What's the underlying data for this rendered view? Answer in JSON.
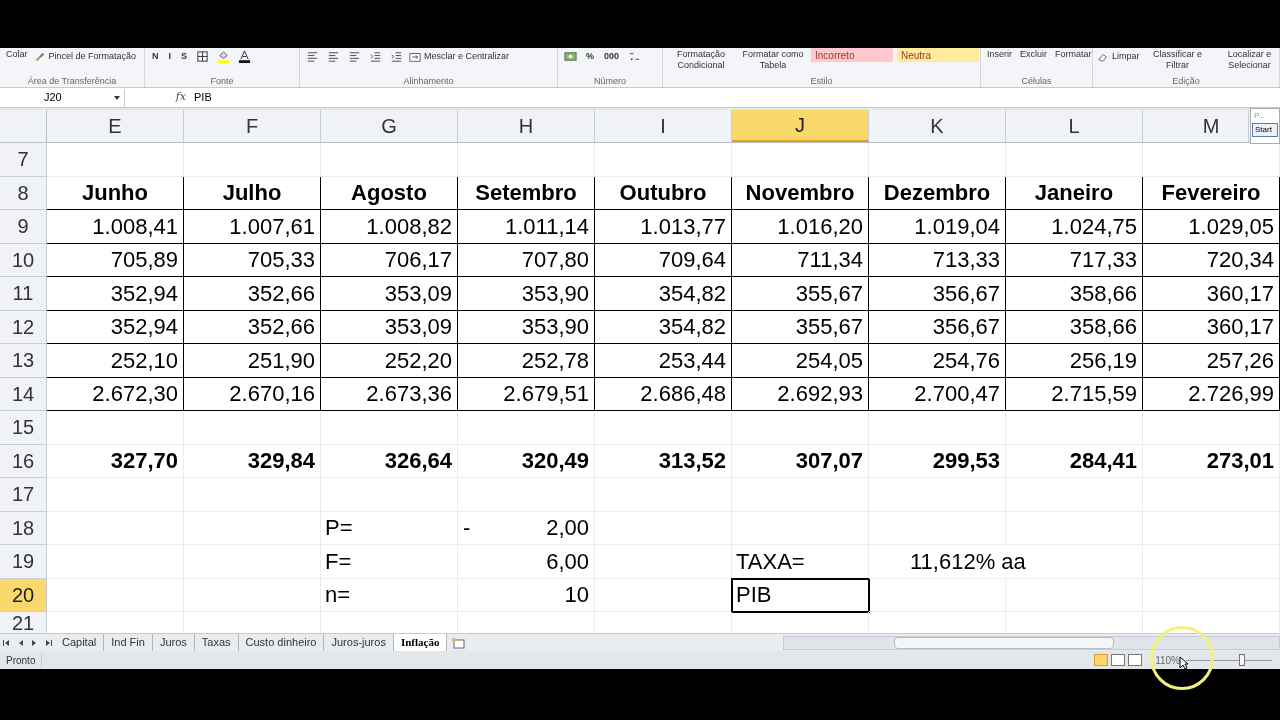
{
  "ribbon": {
    "groups": [
      {
        "label": "Área de Transferência",
        "buttons": [
          {
            "kind": "large",
            "text": "Colar"
          },
          {
            "kind": "small",
            "text": "Pincel de Formatação"
          }
        ]
      },
      {
        "label": "Fonte",
        "buttons": [
          {
            "kind": "glyph",
            "text": "N"
          },
          {
            "kind": "glyph",
            "text": "I"
          },
          {
            "kind": "glyph",
            "text": "S"
          }
        ]
      },
      {
        "label": "Alinhamento",
        "buttons": [
          {
            "kind": "small",
            "text": "Mesclar e Centralizar"
          }
        ]
      },
      {
        "label": "Número",
        "buttons": [
          {
            "kind": "glyph",
            "text": "%"
          },
          {
            "kind": "glyph",
            "text": "000"
          }
        ]
      },
      {
        "label": "Estilo",
        "buttons": [
          {
            "kind": "large",
            "text": "Formatação Condicional"
          },
          {
            "kind": "large",
            "text": "Formatar como Tabela"
          },
          {
            "kind": "style",
            "text": "Incorreto",
            "color": "#ffc7ce"
          },
          {
            "kind": "style",
            "text": "Neutra",
            "color": "#ffeb9c"
          }
        ]
      },
      {
        "label": "Células",
        "buttons": [
          {
            "kind": "large",
            "text": "Inserir"
          },
          {
            "kind": "large",
            "text": "Excluir"
          },
          {
            "kind": "large",
            "text": "Formatar"
          }
        ]
      },
      {
        "label": "Edição",
        "buttons": [
          {
            "kind": "small",
            "text": "Limpar"
          },
          {
            "kind": "large",
            "text": "Classificar e Filtrar"
          },
          {
            "kind": "large",
            "text": "Localizar e Selecionar"
          }
        ]
      }
    ]
  },
  "formula_bar": {
    "name_box": "J20",
    "function_label": "fx",
    "formula": "PIB"
  },
  "columns": [
    {
      "label": "E",
      "selected": false
    },
    {
      "label": "F",
      "selected": false
    },
    {
      "label": "G",
      "selected": false
    },
    {
      "label": "H",
      "selected": false
    },
    {
      "label": "I",
      "selected": false
    },
    {
      "label": "J",
      "selected": true
    },
    {
      "label": "K",
      "selected": false
    },
    {
      "label": "L",
      "selected": false
    },
    {
      "label": "M",
      "selected": false
    }
  ],
  "rows": [
    {
      "number": "7",
      "kind": "plain",
      "selected": false
    },
    {
      "number": "8",
      "kind": "table_header",
      "selected": false,
      "cells": [
        {
          "kind": "label",
          "text": "Junho"
        },
        {
          "kind": "label",
          "text": "Julho"
        },
        {
          "kind": "label",
          "text": "Agosto"
        },
        {
          "kind": "label",
          "text": "Setembro"
        },
        {
          "kind": "label",
          "text": "Outubro"
        },
        {
          "kind": "label",
          "text": "Novembro"
        },
        {
          "kind": "label",
          "text": "Dezembro"
        },
        {
          "kind": "label",
          "text": "Janeiro"
        },
        {
          "kind": "label",
          "text": "Fevereiro"
        }
      ]
    },
    {
      "number": "9",
      "kind": "table",
      "selected": false,
      "cells": [
        {
          "kind": "number",
          "text": "1.008,41"
        },
        {
          "kind": "number",
          "text": "1.007,61"
        },
        {
          "kind": "number",
          "text": "1.008,82"
        },
        {
          "kind": "number",
          "text": "1.011,14"
        },
        {
          "kind": "number",
          "text": "1.013,77"
        },
        {
          "kind": "number",
          "text": "1.016,20"
        },
        {
          "kind": "number",
          "text": "1.019,04"
        },
        {
          "kind": "number",
          "text": "1.024,75"
        },
        {
          "kind": "number",
          "text": "1.029,05"
        }
      ]
    },
    {
      "number": "10",
      "kind": "table",
      "selected": false,
      "cells": [
        {
          "kind": "number",
          "text": "705,89"
        },
        {
          "kind": "number",
          "text": "705,33"
        },
        {
          "kind": "number",
          "text": "706,17"
        },
        {
          "kind": "number",
          "text": "707,80"
        },
        {
          "kind": "number",
          "text": "709,64"
        },
        {
          "kind": "number",
          "text": "711,34"
        },
        {
          "kind": "number",
          "text": "713,33"
        },
        {
          "kind": "number",
          "text": "717,33"
        },
        {
          "kind": "number",
          "text": "720,34"
        }
      ]
    },
    {
      "number": "11",
      "kind": "table",
      "selected": false,
      "cells": [
        {
          "kind": "number",
          "text": "352,94"
        },
        {
          "kind": "number",
          "text": "352,66"
        },
        {
          "kind": "number",
          "text": "353,09"
        },
        {
          "kind": "number",
          "text": "353,90"
        },
        {
          "kind": "number",
          "text": "354,82"
        },
        {
          "kind": "number",
          "text": "355,67"
        },
        {
          "kind": "number",
          "text": "356,67"
        },
        {
          "kind": "number",
          "text": "358,66"
        },
        {
          "kind": "number",
          "text": "360,17"
        }
      ]
    },
    {
      "number": "12",
      "kind": "table",
      "selected": false,
      "cells": [
        {
          "kind": "number",
          "text": "352,94"
        },
        {
          "kind": "number",
          "text": "352,66"
        },
        {
          "kind": "number",
          "text": "353,09"
        },
        {
          "kind": "number",
          "text": "353,90"
        },
        {
          "kind": "number",
          "text": "354,82"
        },
        {
          "kind": "number",
          "text": "355,67"
        },
        {
          "kind": "number",
          "text": "356,67"
        },
        {
          "kind": "number",
          "text": "358,66"
        },
        {
          "kind": "number",
          "text": "360,17"
        }
      ]
    },
    {
      "number": "13",
      "kind": "table",
      "selected": false,
      "cells": [
        {
          "kind": "number",
          "text": "252,10"
        },
        {
          "kind": "number",
          "text": "251,90"
        },
        {
          "kind": "number",
          "text": "252,20"
        },
        {
          "kind": "number",
          "text": "252,78"
        },
        {
          "kind": "number",
          "text": "253,44"
        },
        {
          "kind": "number",
          "text": "254,05"
        },
        {
          "kind": "number",
          "text": "254,76"
        },
        {
          "kind": "number",
          "text": "256,19"
        },
        {
          "kind": "number",
          "text": "257,26"
        }
      ]
    },
    {
      "number": "14",
      "kind": "table",
      "selected": false,
      "cells": [
        {
          "kind": "number",
          "text": "2.672,30"
        },
        {
          "kind": "number",
          "text": "2.670,16"
        },
        {
          "kind": "number",
          "text": "2.673,36"
        },
        {
          "kind": "number",
          "text": "2.679,51"
        },
        {
          "kind": "number",
          "text": "2.686,48"
        },
        {
          "kind": "number",
          "text": "2.692,93"
        },
        {
          "kind": "number",
          "text": "2.700,47"
        },
        {
          "kind": "number",
          "text": "2.715,59"
        },
        {
          "kind": "number",
          "text": "2.726,99"
        }
      ]
    },
    {
      "number": "15",
      "kind": "plain",
      "selected": false
    },
    {
      "number": "16",
      "kind": "total",
      "selected": false,
      "cells": [
        {
          "kind": "number",
          "text": "327,70"
        },
        {
          "kind": "number",
          "text": "329,84"
        },
        {
          "kind": "number",
          "text": "326,64"
        },
        {
          "kind": "number",
          "text": "320,49"
        },
        {
          "kind": "number",
          "text": "313,52"
        },
        {
          "kind": "number",
          "text": "307,07"
        },
        {
          "kind": "number",
          "text": "299,53"
        },
        {
          "kind": "number",
          "text": "284,41"
        },
        {
          "kind": "number",
          "text": "273,01"
        }
      ]
    },
    {
      "number": "17",
      "kind": "plain",
      "selected": false
    },
    {
      "number": "18",
      "kind": "plain",
      "selected": false,
      "cells": [
        {
          "kind": "empty"
        },
        {
          "kind": "empty"
        },
        {
          "kind": "label",
          "text": "P="
        },
        {
          "kind": "accounting",
          "sign": "-",
          "text": "2,00"
        },
        {
          "kind": "empty"
        },
        {
          "kind": "empty"
        },
        {
          "kind": "empty"
        },
        {
          "kind": "empty"
        },
        {
          "kind": "empty"
        }
      ]
    },
    {
      "number": "19",
      "kind": "plain",
      "selected": false,
      "cells": [
        {
          "kind": "empty"
        },
        {
          "kind": "empty"
        },
        {
          "kind": "label",
          "text": "F="
        },
        {
          "kind": "number",
          "text": "6,00"
        },
        {
          "kind": "empty"
        },
        {
          "kind": "label",
          "text": "TAXA="
        },
        {
          "kind": "indented",
          "text": "11,612% aa"
        },
        {
          "kind": "empty"
        }
      ]
    },
    {
      "number": "20",
      "kind": "plain",
      "selected": true,
      "cells": [
        {
          "kind": "empty"
        },
        {
          "kind": "empty"
        },
        {
          "kind": "label",
          "text": "n="
        },
        {
          "kind": "number",
          "text": "10"
        },
        {
          "kind": "empty"
        },
        {
          "kind": "label",
          "text": "PIB",
          "active": true
        },
        {
          "kind": "empty"
        },
        {
          "kind": "empty"
        },
        {
          "kind": "empty"
        }
      ]
    },
    {
      "number": "21",
      "kind": "plain",
      "selected": false
    }
  ],
  "popup": [
    "P...",
    "Start"
  ],
  "sheet_tabs": [
    {
      "label": "Capital",
      "selected": false
    },
    {
      "label": "Ind Fin",
      "selected": false
    },
    {
      "label": "Juros",
      "selected": false
    },
    {
      "label": "Taxas",
      "selected": false
    },
    {
      "label": "Custo dinheiro",
      "selected": false
    },
    {
      "label": "Juros-juros",
      "selected": false
    },
    {
      "label": "Inflação",
      "selected": true
    }
  ],
  "status_bar": {
    "status": "Pronto",
    "zoom": "110%",
    "zoom_level": {
      "level": 0.65
    }
  }
}
